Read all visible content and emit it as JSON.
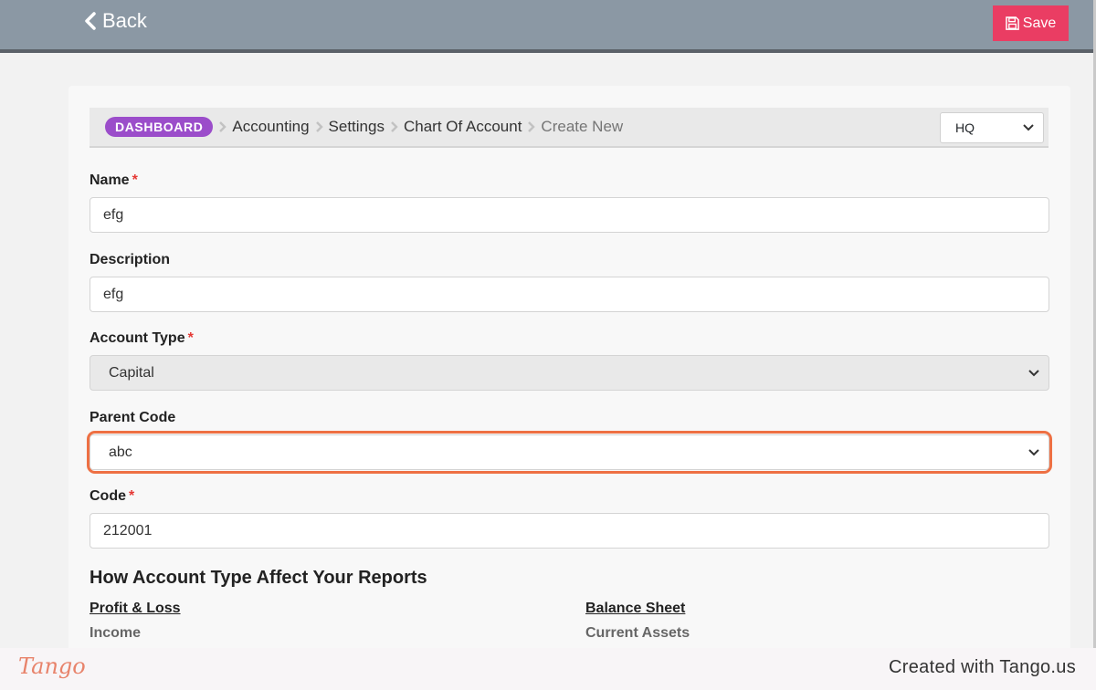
{
  "header": {
    "back_label": "Back",
    "save_label": "Save"
  },
  "breadcrumb": {
    "dashboard": "DASHBOARD",
    "items": [
      "Accounting",
      "Settings",
      "Chart Of Account"
    ],
    "current": "Create New"
  },
  "branch_select": {
    "value": "HQ"
  },
  "form": {
    "name": {
      "label": "Name",
      "required": "*",
      "value": "efg"
    },
    "description": {
      "label": "Description",
      "value": "efg"
    },
    "account_type": {
      "label": "Account Type",
      "required": "*",
      "value": "Capital"
    },
    "parent_code": {
      "label": "Parent Code",
      "value": "abc"
    },
    "code": {
      "label": "Code",
      "required": "*",
      "value": "212001"
    }
  },
  "reports": {
    "title": "How Account Type Affect Your Reports",
    "profit_loss": {
      "heading": "Profit & Loss",
      "first_item": "Income"
    },
    "balance_sheet": {
      "heading": "Balance Sheet",
      "first_item": "Current Assets"
    }
  },
  "footer": {
    "logo": "Tango",
    "created_with": "Created with Tango.us"
  },
  "colors": {
    "topbar": "#8b98a4",
    "save_button": "#ea3d63",
    "dashboard_badge": "#9b4dca",
    "highlight": "#ee7043"
  }
}
